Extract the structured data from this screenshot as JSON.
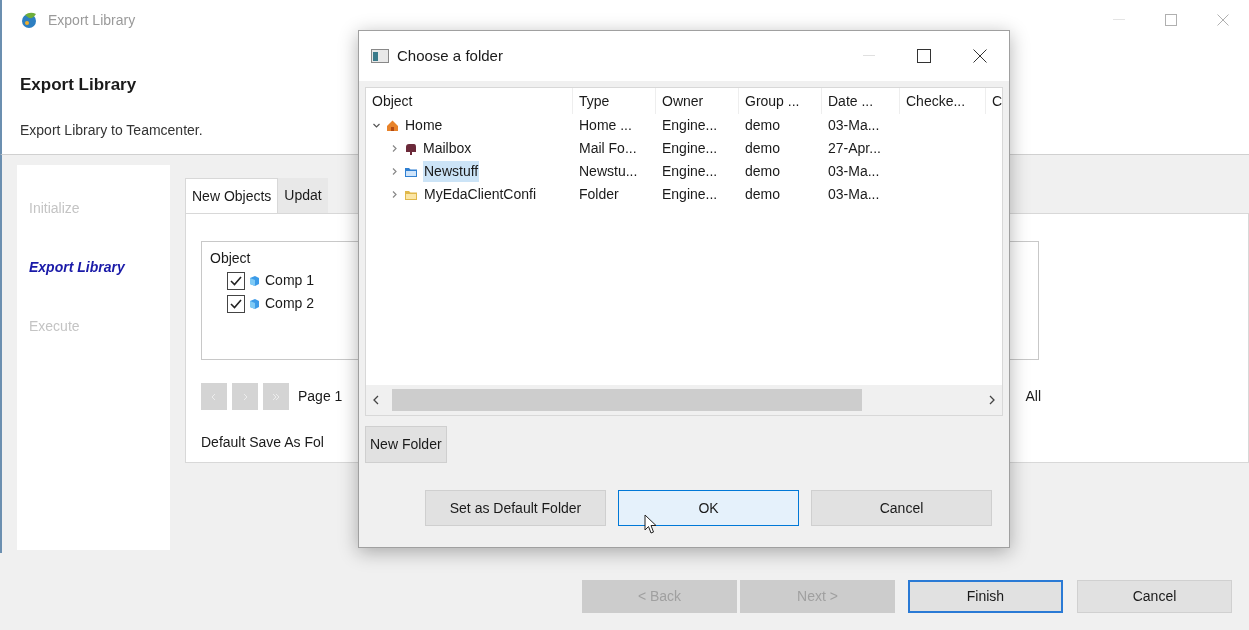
{
  "window": {
    "title": "Export Library"
  },
  "header": {
    "title": "Export Library",
    "subtitle": "Export Library to Teamcenter."
  },
  "steps": [
    {
      "label": "Initialize",
      "selected": false
    },
    {
      "label": "Export Library",
      "selected": true
    },
    {
      "label": "Execute",
      "selected": false
    }
  ],
  "tabs": [
    {
      "label": "New Objects",
      "selected": true
    },
    {
      "label": "Updat",
      "selected": false
    }
  ],
  "object_list": {
    "heading": "Object",
    "items": [
      {
        "label": "Comp 1",
        "checked": true
      },
      {
        "label": "Comp 2",
        "checked": true
      }
    ]
  },
  "pager": {
    "page_label": "Page 1",
    "select_label": "All"
  },
  "default_save_label": "Default Save As Fol",
  "buttons": [
    {
      "label": "< Back",
      "disabled": true,
      "focused": false
    },
    {
      "label": "Next >",
      "disabled": true,
      "focused": false
    },
    {
      "label": "Finish",
      "disabled": false,
      "focused": true
    },
    {
      "label": "Cancel",
      "disabled": false,
      "focused": false
    }
  ],
  "dialog": {
    "title": "Choose a folder",
    "columns": [
      "Object",
      "Type",
      "Owner",
      "Group ...",
      "Date ...",
      "Checke...",
      "C"
    ],
    "rows": [
      {
        "kind": "home",
        "object": "Home",
        "type": "Home ...",
        "owner": "Engine...",
        "group": "demo",
        "date": "03-Ma...",
        "expanded": true,
        "selected": false,
        "children": [
          {
            "kind": "mailbox",
            "object": "Mailbox",
            "type": "Mail Fo...",
            "owner": "Engine...",
            "group": "demo",
            "date": "27-Apr...",
            "expanded": false,
            "selected": false
          },
          {
            "kind": "shared-folder",
            "object": "Newstuff",
            "type": "Newstu...",
            "owner": "Engine...",
            "group": "demo",
            "date": "03-Ma...",
            "expanded": false,
            "selected": true
          },
          {
            "kind": "folder",
            "object": "MyEdaClientConfi",
            "type": "Folder",
            "owner": "Engine...",
            "group": "demo",
            "date": "03-Ma...",
            "expanded": false,
            "selected": false
          }
        ]
      }
    ],
    "new_folder_button": "New Folder",
    "buttons": [
      {
        "label": "Set as Default Folder",
        "focused": false
      },
      {
        "label": "OK",
        "focused": true
      },
      {
        "label": "Cancel",
        "focused": false
      }
    ]
  }
}
